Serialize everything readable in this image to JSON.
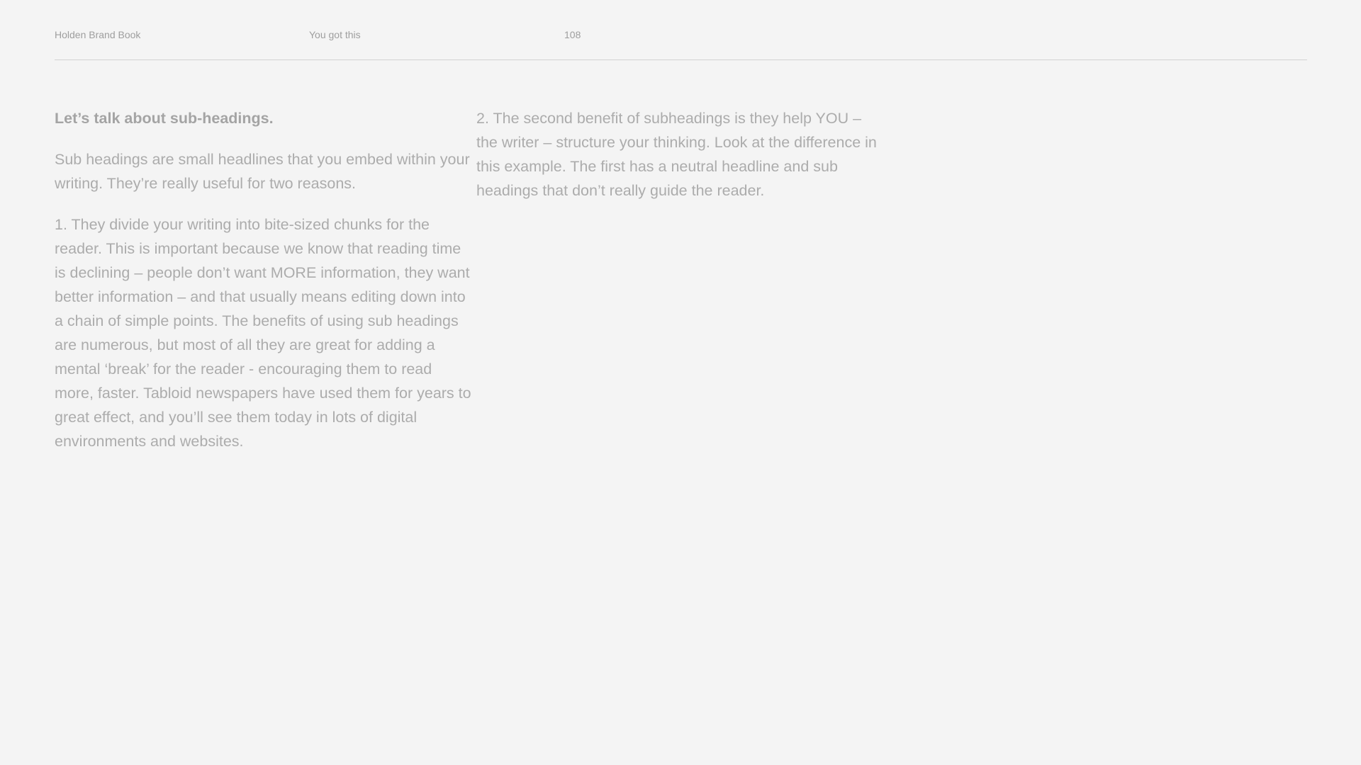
{
  "header": {
    "book_title": "Holden Brand Book",
    "section_title": "You got this",
    "page_number": "108"
  },
  "content": {
    "heading": "Let’s talk about sub-headings.",
    "intro": "Sub headings are small headlines that you embed within your writing. They’re really useful for two reasons.",
    "point_one": "1. They divide your writing into bite-sized chunks for the reader. This is important because we know that reading time is declining – people don’t want MORE information, they want better information – and that usually means editing down into a chain of simple points. The benefits of using sub headings are numerous, but most of all they are great for adding a mental ‘break’ for the reader - encouraging them to read more, faster. Tabloid newspapers have used them for years to great effect, and you’ll see them today in lots of digital environments and websites.",
    "point_two": "2. The second benefit of subheadings is they help YOU – the writer – structure your thinking. Look at the difference in this example. The first has a neutral headline and sub headings that don’t really guide the reader."
  }
}
